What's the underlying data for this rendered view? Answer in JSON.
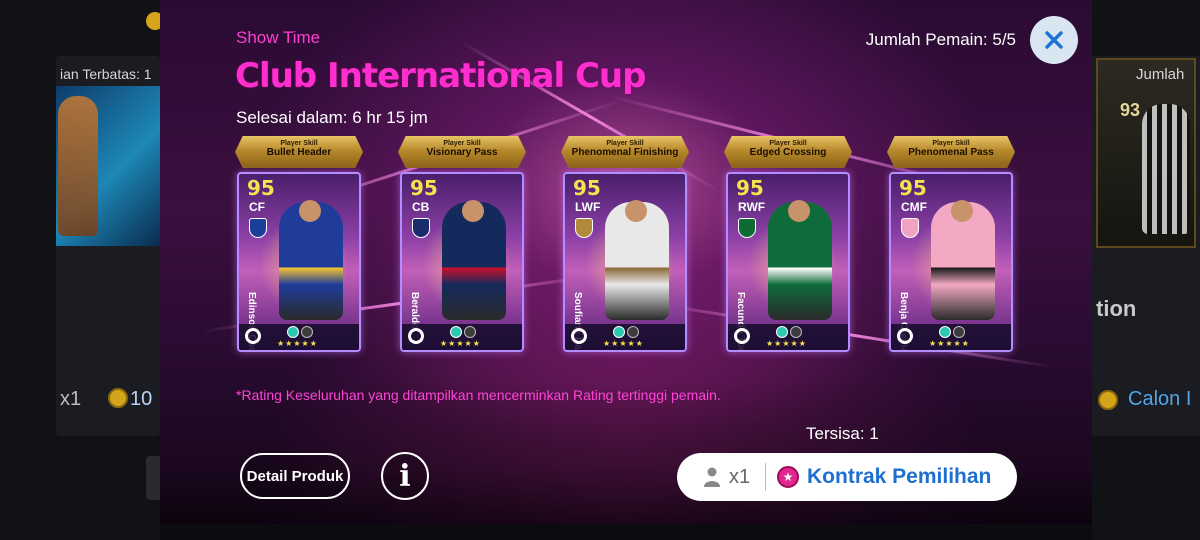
{
  "background": {
    "left_title": "ian Terbatas: 1",
    "left_multiplier": "x1",
    "left_coin_value": "10",
    "right_count_label": "Jumlah",
    "right_card_rating": "93",
    "right_section_text": "tion",
    "right_button_text": "Calon I"
  },
  "modal": {
    "label": "Show Time",
    "title": "Club International Cup",
    "ends_in": "Selesai dalam: 6 hr 15 jm",
    "player_count": "Jumlah Pemain: 5/5",
    "note": "*Rating Keseluruhan yang ditampilkan mencerminkan Rating tertinggi pemain.",
    "remaining": "Tersisa: 1",
    "detail_button": "Detail Produk",
    "info_button": "i",
    "contract": {
      "count": "x1",
      "label": "Kontrak Pemilihan"
    }
  },
  "cards": [
    {
      "skill_pre": "Player Skill",
      "skill": "Bullet Header",
      "rating": "95",
      "position": "CF",
      "name": "Edinson Cavani",
      "kit": "#1f3c9b",
      "kit2": "#f2c230",
      "club": "#1b3f99"
    },
    {
      "skill_pre": "Player Skill",
      "skill": "Visionary Pass",
      "rating": "95",
      "position": "CB",
      "name": "Beraldo",
      "kit": "#152a5c",
      "kit2": "#c8102e",
      "club": "#1a2d6b"
    },
    {
      "skill_pre": "Player Skill",
      "skill": "Phenomenal Finishing",
      "rating": "95",
      "position": "LWF",
      "name": "Soufiane Rahimi",
      "kit": "#e8e8e8",
      "kit2": "#8a6b3a",
      "club": "#b08a3a"
    },
    {
      "skill_pre": "Player Skill",
      "skill": "Edged Crossing",
      "rating": "95",
      "position": "RWF",
      "name": "Facundo Torres",
      "kit": "#0f6b3a",
      "kit2": "#ffffff",
      "club": "#0d6b34"
    },
    {
      "skill_pre": "Player Skill",
      "skill": "Phenomenal Pass",
      "rating": "95",
      "position": "CMF",
      "name": "Benja Cremaschi",
      "kit": "#f3a9c4",
      "kit2": "#1a1a1a",
      "club": "#f1a3c3"
    }
  ]
}
